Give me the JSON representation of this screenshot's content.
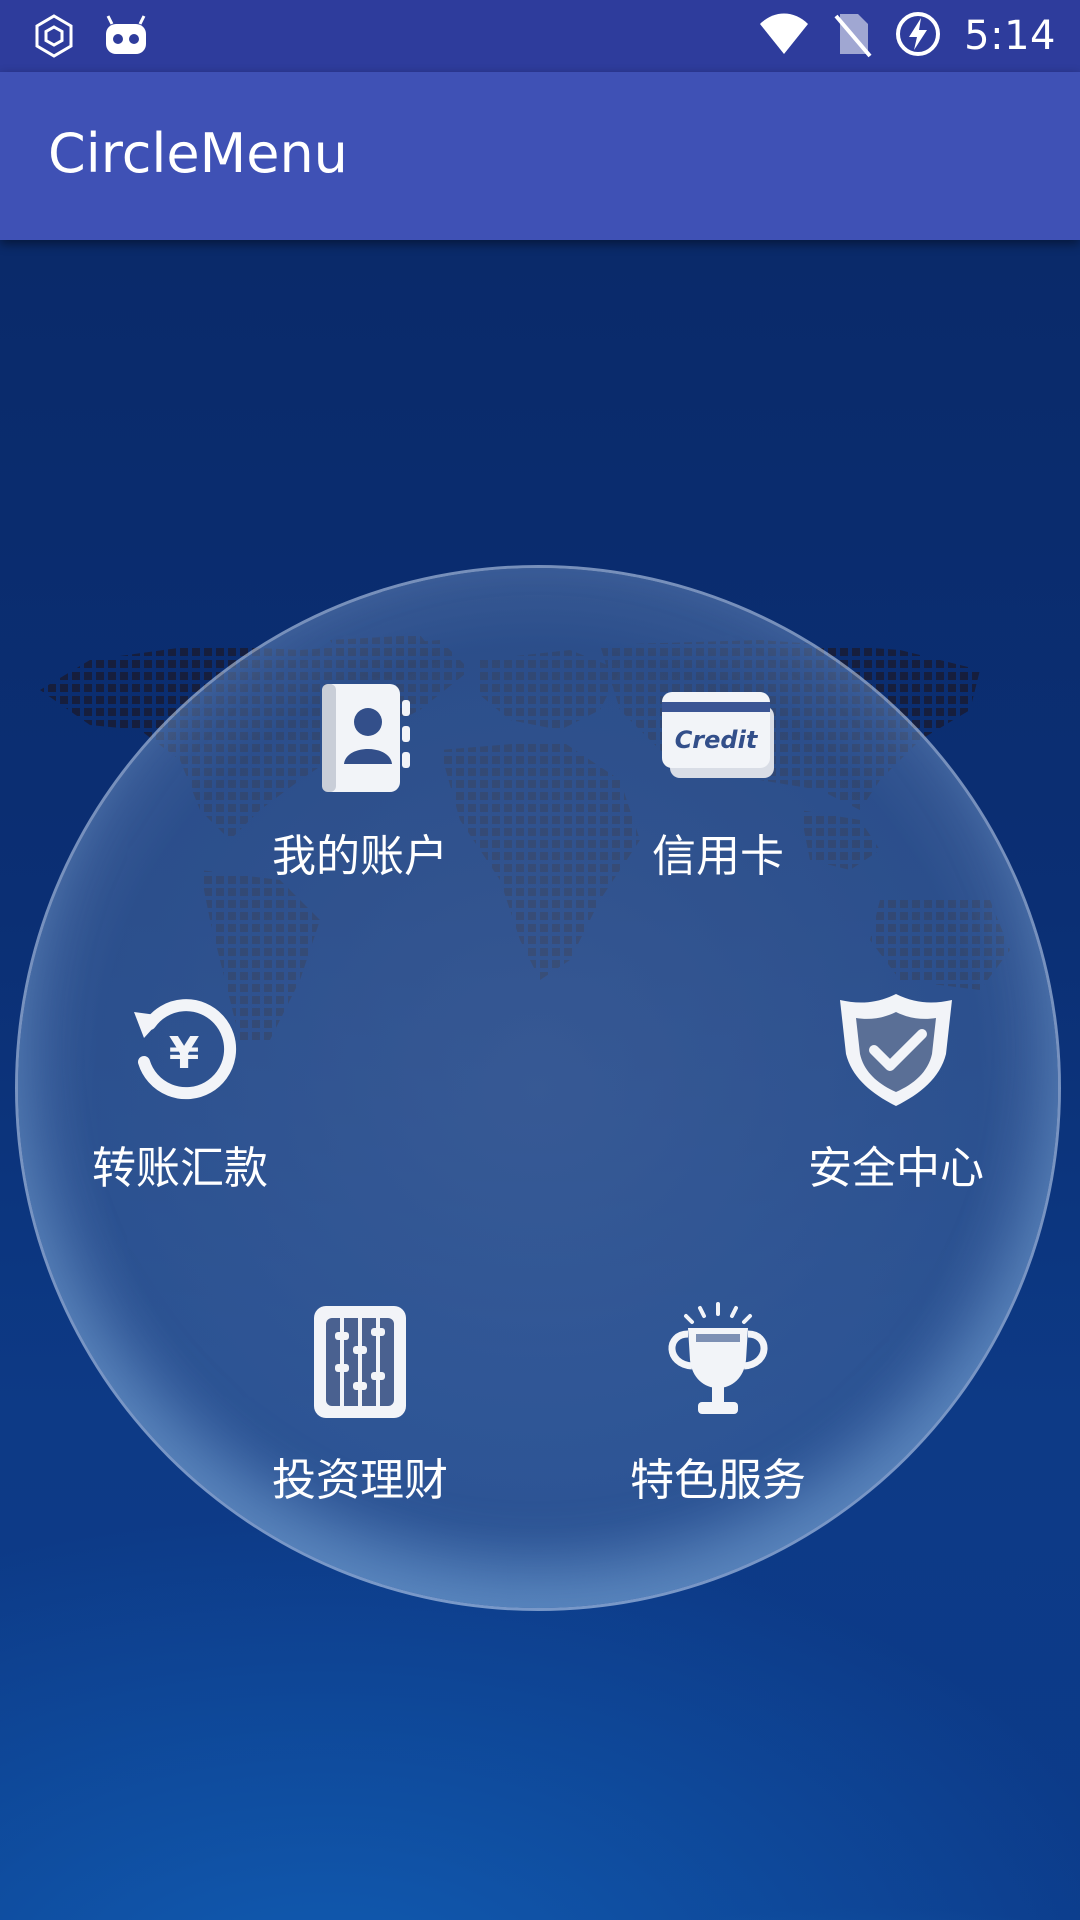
{
  "status_bar": {
    "time": "5:14",
    "icons": [
      "settings-hex-icon",
      "android-robot-icon",
      "wifi-icon",
      "no-sim-icon",
      "battery-charging-icon"
    ]
  },
  "app_bar": {
    "title": "CircleMenu"
  },
  "colors": {
    "status_bar": "#2e3c9c",
    "app_bar": "#3f51b5",
    "background": "#0b2f74"
  },
  "menu": {
    "items": [
      {
        "label": "我的账户",
        "icon": "contacts-book-icon"
      },
      {
        "label": "信用卡",
        "icon": "credit-card-icon",
        "icon_text": "Credit"
      },
      {
        "label": "转账汇款",
        "icon": "yen-transfer-icon",
        "icon_text": "¥"
      },
      {
        "label": "安全中心",
        "icon": "shield-check-icon"
      },
      {
        "label": "投资理财",
        "icon": "abacus-icon"
      },
      {
        "label": "特色服务",
        "icon": "trophy-icon"
      }
    ]
  }
}
